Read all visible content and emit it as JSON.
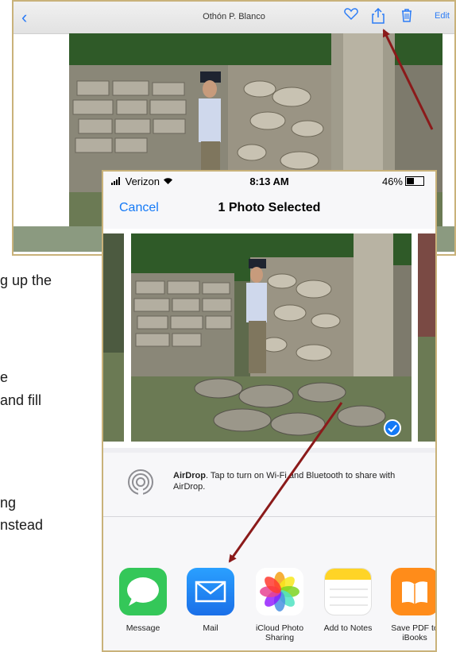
{
  "doc": {
    "lines": [
      "g up the",
      "e",
      "and fill",
      "ng",
      "nstead"
    ]
  },
  "back_screen": {
    "title": "Othón P. Blanco",
    "back_glyph": "‹",
    "edit_label": "Edit",
    "icons": [
      "back-chevron-icon",
      "heart-icon",
      "share-icon",
      "trash-icon"
    ]
  },
  "front_screen": {
    "status": {
      "carrier": "Verizon",
      "time": "8:13 AM",
      "battery": "46%"
    },
    "nav": {
      "cancel_label": "Cancel",
      "title": "1 Photo Selected"
    },
    "airdrop": {
      "bold": "AirDrop",
      "text": ". Tap to turn on Wi-Fi and Bluetooth to share with AirDrop."
    },
    "apps": [
      {
        "label": "Message",
        "icon": "messages-icon",
        "color": "#34c759"
      },
      {
        "label": "Mail",
        "icon": "mail-icon",
        "color": "#1f8bf5"
      },
      {
        "label": "iCloud Photo Sharing",
        "icon": "photos-icon",
        "color": "#ffffff"
      },
      {
        "label": "Add to Notes",
        "icon": "notes-icon",
        "color": "#ffffff"
      },
      {
        "label": "Save PDF to iBooks",
        "icon": "ibooks-icon",
        "color": "#ff8c1a"
      }
    ]
  },
  "colors": {
    "accent": "#1479f6",
    "frame": "#c9b27a",
    "arrow": "#8b1a1a"
  }
}
